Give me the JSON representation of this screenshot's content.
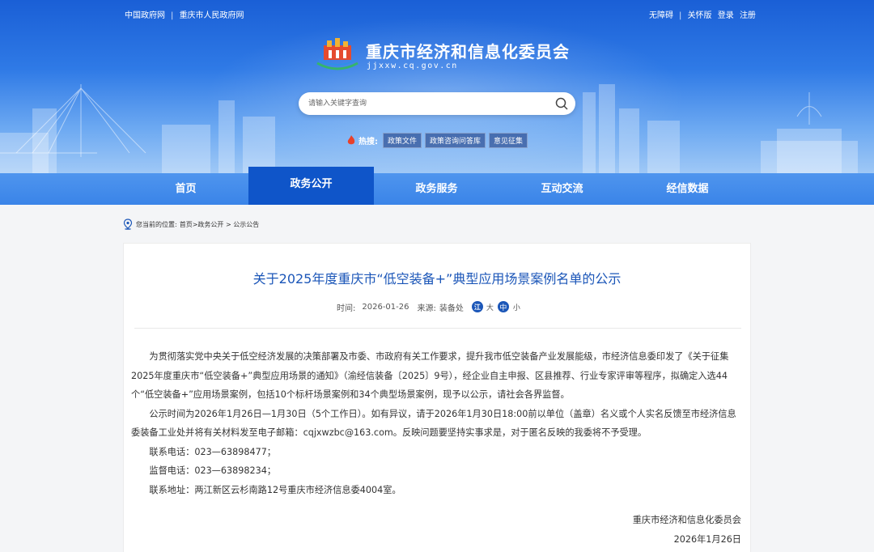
{
  "topbar": {
    "left_links": [
      "中国政府网",
      "重庆市人民政府网"
    ],
    "right_links": [
      "无障碍",
      "关怀版",
      "登录",
      "注册"
    ]
  },
  "site": {
    "title": "重庆市经济和信息化委员会",
    "domain": "jjxxw.cq.gov.cn"
  },
  "search": {
    "placeholder": "请输入关键字查询"
  },
  "hot": {
    "label": "热搜:",
    "tags": [
      "政策文件",
      "政策咨询问答库",
      "意见征集"
    ]
  },
  "nav": {
    "items": [
      "首页",
      "政务公开",
      "政务服务",
      "互动交流",
      "经信数据"
    ],
    "active_index": 1
  },
  "breadcrumb": {
    "prefix": "您当前的位置:",
    "path": "首页>政务公开 > 公示公告"
  },
  "article": {
    "title": "关于2025年度重庆市“低空装备+”典型应用场景案例名单的公示",
    "time_label": "时间:",
    "date": "2026-01-26",
    "source_label": "来源:",
    "source": "装备处",
    "font_sizes": [
      "大",
      "中",
      "小"
    ],
    "share_glyph": "江",
    "paragraphs": [
      "为贯彻落实党中央关于低空经济发展的决策部署及市委、市政府有关工作要求，提升我市低空装备产业发展能级，市经济信息委印发了《关于征集2025年度重庆市“低空装备+”典型应用场景的通知》（渝经信装备〔2025〕9号），经企业自主申报、区县推荐、行业专家评审等程序，拟确定入选44个“低空装备+”应用场景案例，包括10个标杆场景案例和34个典型场景案例，现予以公示，请社会各界监督。",
      "公示时间为2026年1月26日—1月30日（5个工作日）。如有异议，请于2026年1月30日18:00前以单位（盖章）名义或个人实名反馈至市经济信息委装备工业处并将有关材料发至电子邮箱：cqjxwzbc@163.com。反映问题要坚持实事求是，对于匿名反映的我委将不予受理。",
      "联系电话：023—63898477；",
      "监督电话：023—63898234；",
      "联系地址：两江新区云杉南路12号重庆市经济信息委4004室。"
    ],
    "signature_org": "重庆市经济和信息化委员会",
    "signature_date": "2026年1月26日"
  },
  "colors": {
    "header_blue": "#1a5fd6",
    "nav_active": "#0f55c9",
    "title_blue": "#1b56b8"
  }
}
